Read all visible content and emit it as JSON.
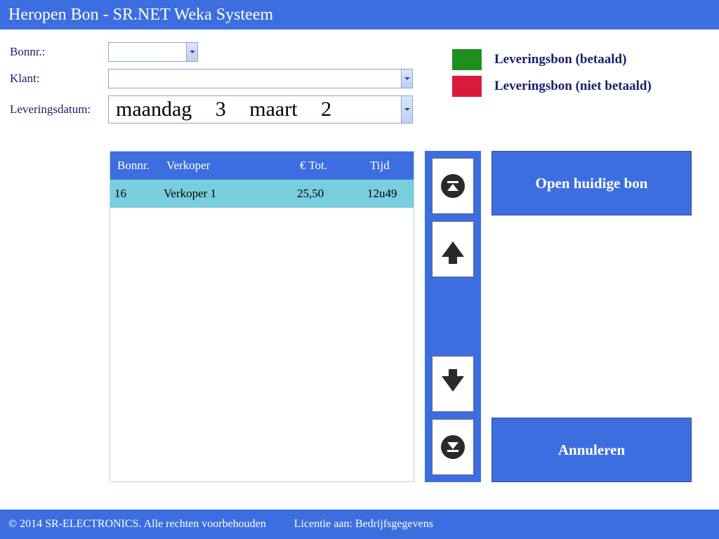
{
  "title": "Heropen Bon - SR.NET Weka Systeem",
  "form": {
    "bonnr_label": "Bonnr.:",
    "bonnr_value": "",
    "klant_label": "Klant:",
    "klant_value": "",
    "date_label": "Leveringsdatum:",
    "date_value": "maandag 3 maart 2"
  },
  "legend": {
    "paid": {
      "color": "#1e8f1e",
      "label": "Leveringsbon (betaald)"
    },
    "unpaid": {
      "color": "#d81b3a",
      "label": "Leveringsbon (niet betaald)"
    }
  },
  "table": {
    "headers": {
      "bonnr": "Bonnr.",
      "verkoper": "Verkoper",
      "tot": "€ Tot.",
      "tijd": "Tijd"
    },
    "rows": [
      {
        "bonnr": "16",
        "verkoper": "Verkoper 1",
        "tot": "25,50",
        "tijd": "12u49",
        "selected": true
      }
    ]
  },
  "nav": {
    "first": "scroll-first",
    "up": "scroll-up",
    "down": "scroll-down",
    "last": "scroll-last"
  },
  "actions": {
    "open": "Open huidige bon",
    "cancel": "Annuleren"
  },
  "footer": {
    "copyright": "© 2014 SR-ELECTRONICS. Alle rechten voorbehouden",
    "license": "Licentie aan: Bedrijfsgegevens"
  }
}
